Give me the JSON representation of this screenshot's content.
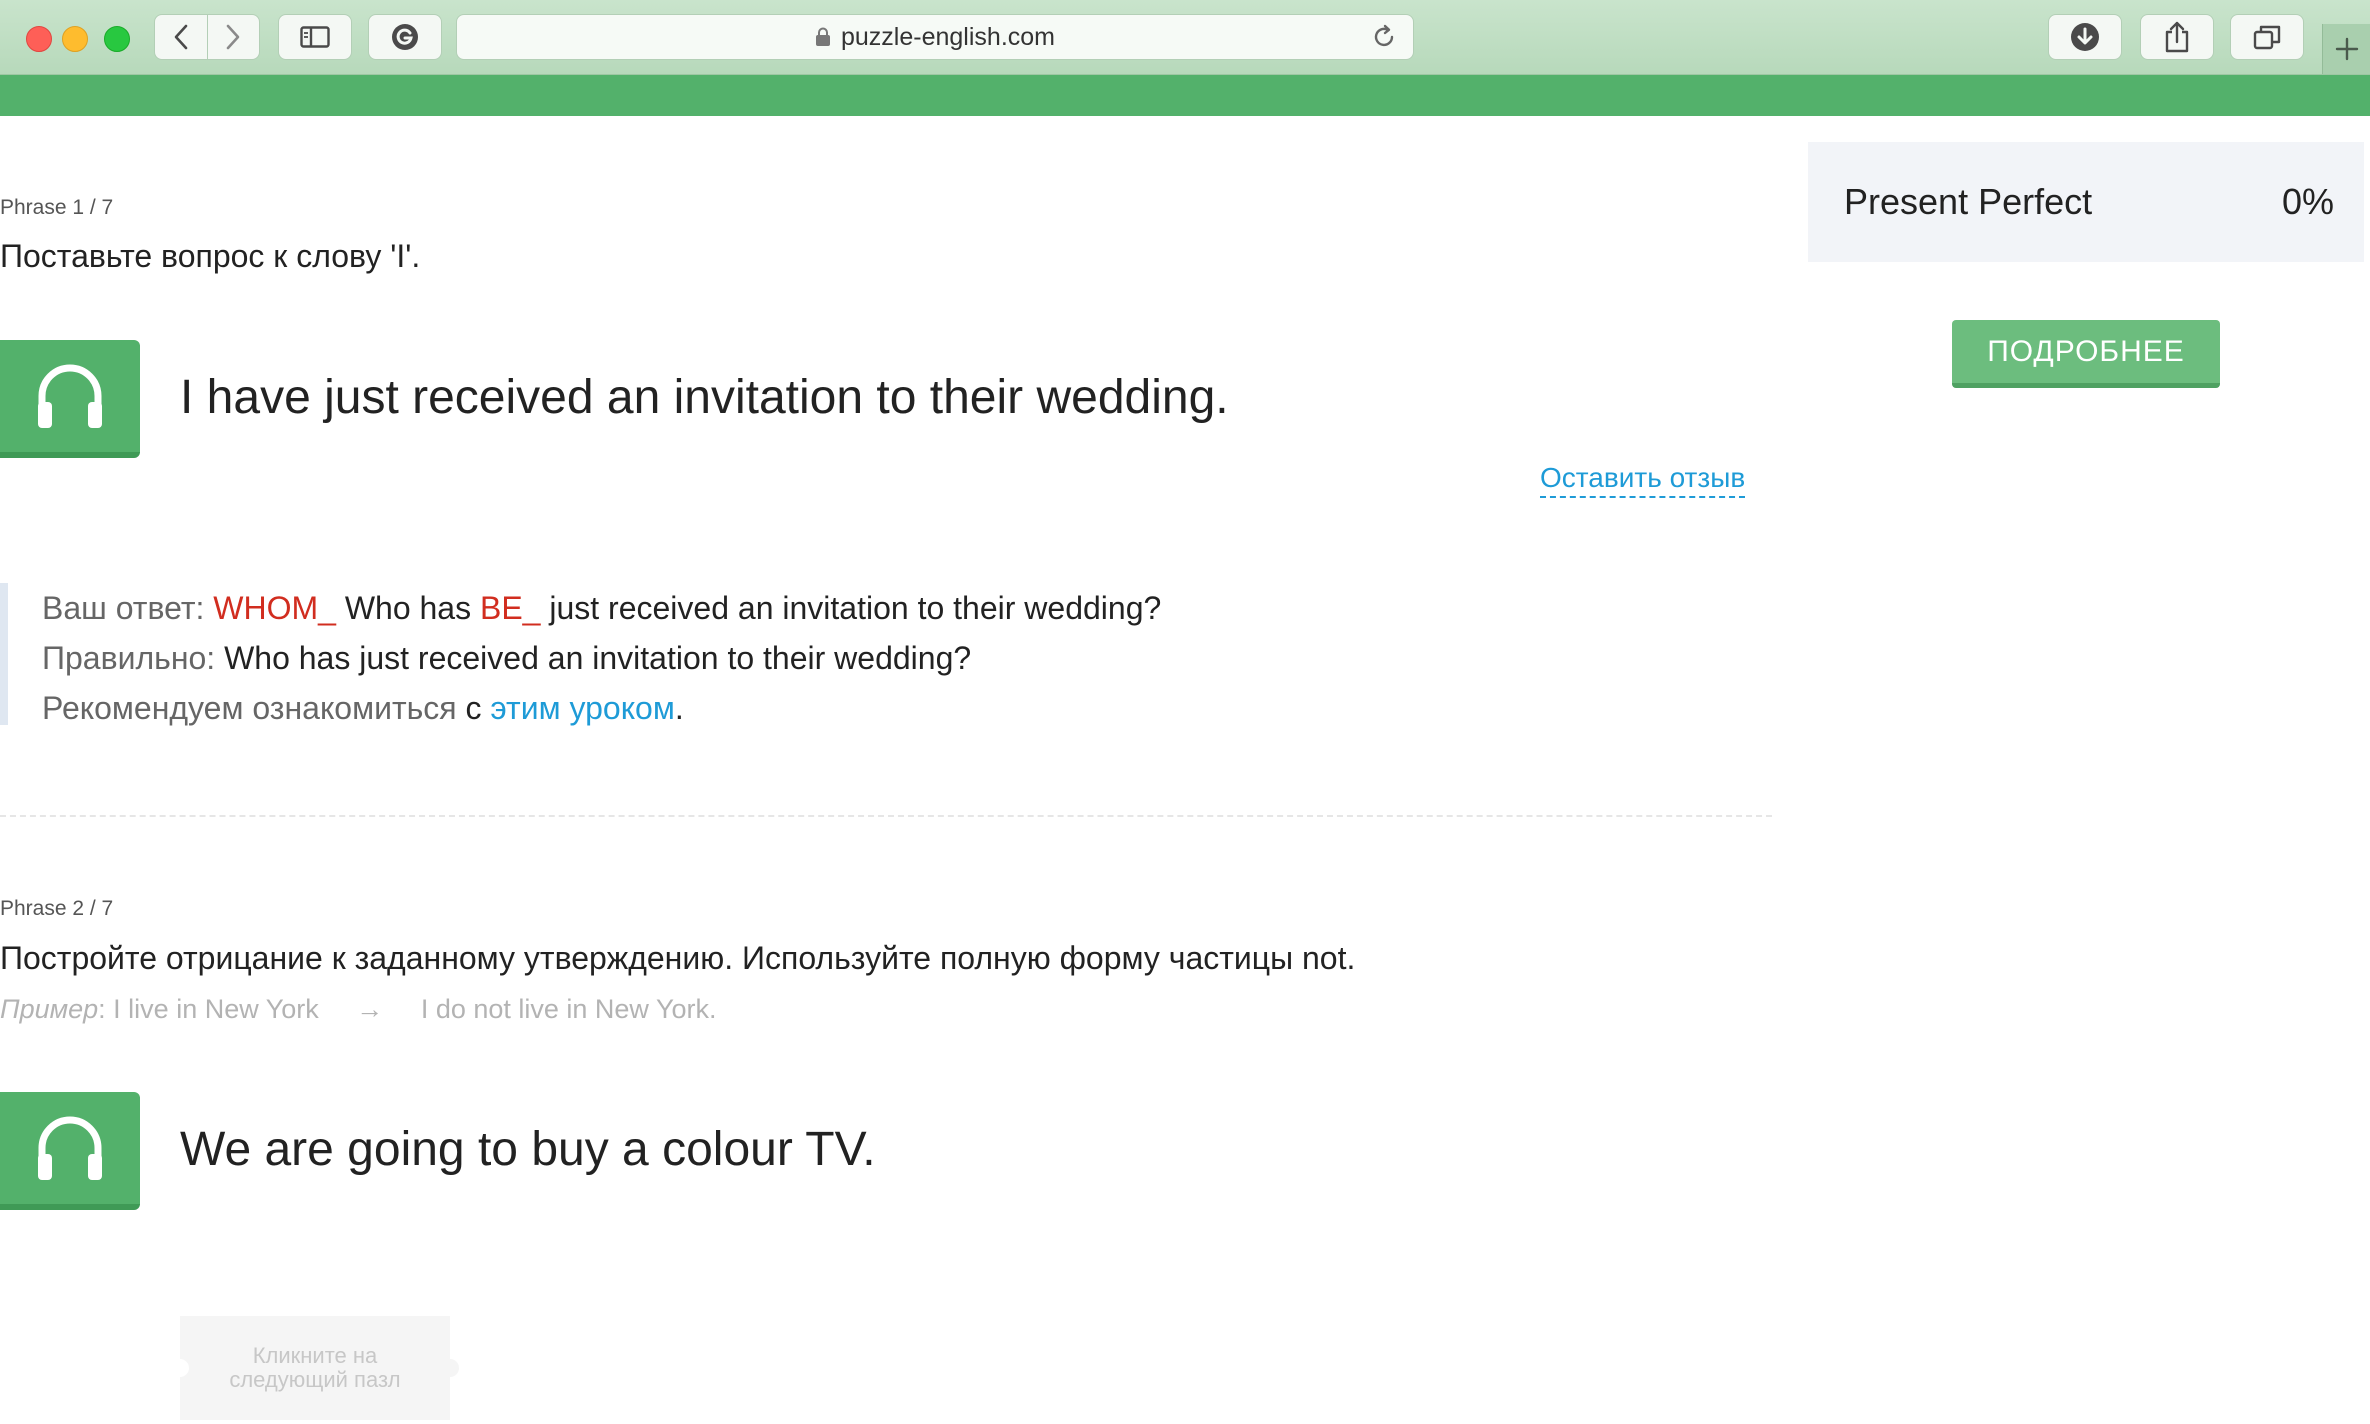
{
  "browser": {
    "url": "puzzle-english.com",
    "icons": [
      "back-icon",
      "forward-icon",
      "sidebar-icon",
      "grammarly-icon",
      "lock-icon",
      "reload-icon",
      "download-icon",
      "share-icon",
      "tabs-icon",
      "plus-icon"
    ]
  },
  "phrases": [
    {
      "number": "Phrase 1 / 7",
      "task": "Поставьте вопрос к слову 'I'.",
      "sentence": "I have just received an invitation to their wedding.",
      "feedback_link": "Оставить отзыв",
      "answer": {
        "label": "Ваш ответ:",
        "wrong1": "WHOM_",
        "part1": "Who has",
        "wrong2": "BE_",
        "part2": "just received an invitation to their wedding?"
      },
      "correct": {
        "label": "Правильно:",
        "text": "Who has just received an invitation to their wedding?"
      },
      "recommend": {
        "prefix": "Рекомендуем ознакомиться",
        "with": "с",
        "link": "этим уроком",
        "suffix": "."
      }
    },
    {
      "number": "Phrase 2 / 7",
      "task": "Постройте отрицание к заданному утверждению. Используйте полную форму частицы not.",
      "example_label": "Пример",
      "example_colon": ":",
      "example_from": "I live in New York",
      "example_arrow": "→",
      "example_to": "I do not live in New York.",
      "sentence": "We are going to buy a colour TV.",
      "puzzle_hint": "Кликните на следующий пазл"
    }
  ],
  "sidebar": {
    "topic": "Present Perfect",
    "progress": "0%",
    "button": "ПОДРОБНЕЕ"
  },
  "colors": {
    "brand_green": "#53b16b",
    "link_blue": "#1e9bd7",
    "error_red": "#d12d1f"
  }
}
